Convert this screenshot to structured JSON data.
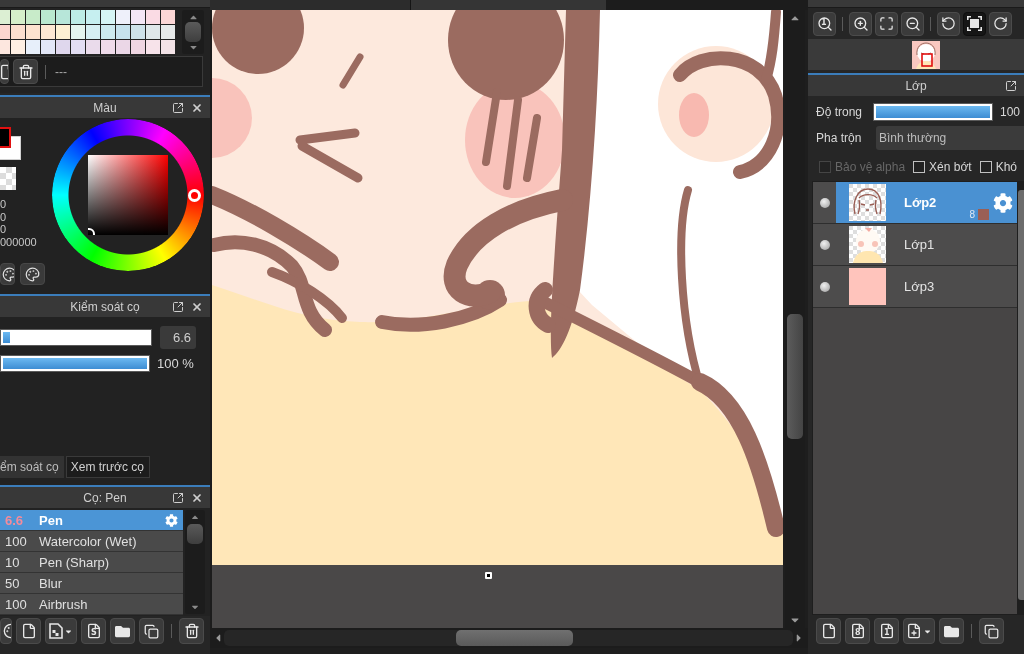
{
  "palette": {
    "swatches": [
      {
        "color": "#dcefd3"
      },
      {
        "color": "#d6efca"
      },
      {
        "color": "#c8ebc9"
      },
      {
        "color": "#b9e8cf"
      },
      {
        "color": "#b7e6d9"
      },
      {
        "color": "#bdece6"
      },
      {
        "color": "#c6eff0"
      },
      {
        "color": "#d6f5f5"
      },
      {
        "color": "#eef0fa"
      },
      {
        "color": "#f4e6f6"
      },
      {
        "color": "#fadbe4"
      },
      {
        "color": "#fcd7d6"
      },
      {
        "color": "#fcd6cf"
      },
      {
        "color": "#fcdfcf"
      },
      {
        "color": "#fde3cf"
      },
      {
        "color": "#fde8d3"
      },
      {
        "color": "#fdf0d3"
      },
      {
        "color": "#e5f5ef"
      },
      {
        "color": "#d6eff3"
      },
      {
        "color": "#cdeaef"
      },
      {
        "color": "#c6e2ed"
      },
      {
        "color": "#cfe2ea"
      },
      {
        "color": "#dfe7ea"
      },
      {
        "color": "#e7eaea"
      },
      {
        "color": "#fde7df"
      },
      {
        "color": "#feefe3"
      },
      {
        "color": "#e7effa"
      },
      {
        "color": "#e3e7f7"
      },
      {
        "color": "#dfd7ed"
      },
      {
        "color": "#e3def3"
      },
      {
        "color": "#eadbeb"
      },
      {
        "color": "#efdbea"
      },
      {
        "color": "#ebd7e7"
      },
      {
        "color": "#efd6e2"
      },
      {
        "color": "#f7e3ea"
      },
      {
        "color": "#f3e3e7"
      }
    ],
    "tools": [
      {
        "kind": "partial-file"
      },
      {
        "kind": "delete"
      }
    ],
    "label": "---"
  },
  "color_panel": {
    "title": "Màu",
    "slots": [
      {
        "color": "#000000",
        "selected": true
      },
      {
        "color": "#ffffff",
        "selected": false
      }
    ],
    "values": [
      "0",
      "0",
      "0",
      "000000"
    ]
  },
  "brush_control": {
    "title": "Kiểm soát cọ",
    "sliders": [
      {
        "kind": "size",
        "level": 0.05,
        "reading": "6.6"
      },
      {
        "kind": "opacity",
        "level": 1,
        "reading": "100 %"
      }
    ],
    "tabs": [
      {
        "label": "ểm soát cọ",
        "selected": true
      },
      {
        "label": "Xem trước cọ",
        "selected": false
      }
    ]
  },
  "brush_panel": {
    "title": "Cọ: Pen",
    "brushes": [
      {
        "size": "6.6",
        "name": "Pen",
        "selected": true
      },
      {
        "size": "100",
        "name": "Watercolor (Wet)",
        "selected": false
      },
      {
        "size": "10",
        "name": "Pen (Sharp)",
        "selected": false
      },
      {
        "size": "50",
        "name": "Blur",
        "selected": false
      },
      {
        "size": "100",
        "name": "Airbrush",
        "selected": false
      }
    ],
    "tools": [
      {
        "kind": "partial"
      },
      {
        "kind": "new"
      },
      {
        "kind": "brush-add"
      },
      {
        "kind": "script",
        "glyph": "S"
      },
      {
        "kind": "folder"
      },
      {
        "kind": "duplicate"
      },
      {
        "kind": "separator"
      },
      {
        "kind": "delete"
      }
    ]
  },
  "navigator": {
    "tools": [
      {
        "kind": "zoom-actual",
        "glyph": "1",
        "selected": false
      },
      {
        "kind": "separator"
      },
      {
        "kind": "zoom-in",
        "selected": false
      },
      {
        "kind": "fit",
        "selected": false
      },
      {
        "kind": "zoom-out",
        "selected": false
      },
      {
        "kind": "separator"
      },
      {
        "kind": "rotate-left",
        "selected": false
      },
      {
        "kind": "fill-screen",
        "selected": true
      },
      {
        "kind": "rotate-right",
        "selected": false
      }
    ]
  },
  "layer_panel": {
    "title": "Lớp",
    "opacity": {
      "label": "Độ trong",
      "level": 1,
      "reading": "100"
    },
    "blend": {
      "label": "Pha trộn",
      "value": "Bình thường"
    },
    "options": [
      {
        "label": "Bảo vệ alpha",
        "checked": false,
        "disabled": true
      },
      {
        "label": "Xén bớt",
        "checked": false,
        "disabled": false
      },
      {
        "label": "Khó",
        "checked": false,
        "disabled": false
      }
    ],
    "layers": [
      {
        "name": "Lớp2",
        "selected": true,
        "visible": true,
        "kind": "lineart",
        "badge": "8",
        "color": "#9a5f55"
      },
      {
        "name": "Lớp1",
        "selected": false,
        "visible": true,
        "kind": "paint"
      },
      {
        "name": "Lớp3",
        "selected": false,
        "visible": true,
        "kind": "fill"
      }
    ],
    "tools": [
      {
        "kind": "new-layer"
      },
      {
        "kind": "layer-8bit",
        "glyph": "8"
      },
      {
        "kind": "layer-1bit",
        "glyph": "1"
      },
      {
        "kind": "layer-add"
      },
      {
        "kind": "folder"
      },
      {
        "kind": "separator"
      },
      {
        "kind": "duplicate"
      }
    ]
  }
}
